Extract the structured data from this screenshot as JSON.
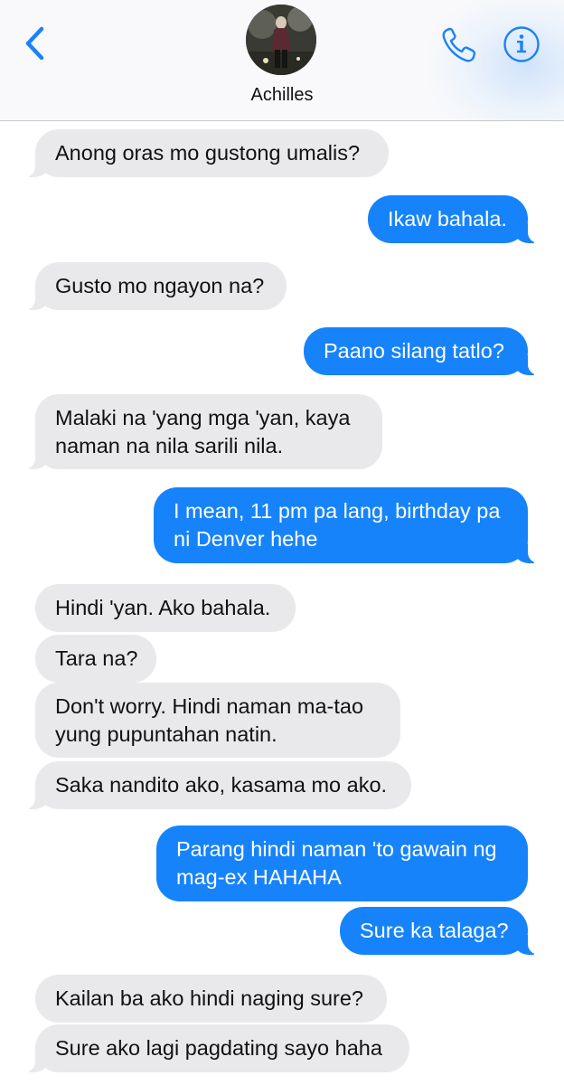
{
  "header": {
    "contact_name": "Achilles",
    "back_icon": "chevron-left-icon",
    "call_icon": "phone-icon",
    "info_icon": "info-icon",
    "accent_color": "#1a82fb"
  },
  "messages": [
    {
      "from": "them",
      "lines": [
        "Anong oras mo gustong umalis?"
      ]
    },
    {
      "from": "me",
      "lines": [
        "Ikaw bahala."
      ]
    },
    {
      "from": "them",
      "lines": [
        "Gusto mo ngayon na?"
      ]
    },
    {
      "from": "me",
      "lines": [
        "Paano silang tatlo?"
      ]
    },
    {
      "from": "them",
      "lines": [
        "Malaki na 'yang mga 'yan, kaya",
        "naman na nila sarili nila."
      ]
    },
    {
      "from": "me",
      "lines": [
        "I mean, 11 pm pa lang, birthday pa",
        "ni Denver hehe"
      ]
    },
    {
      "from": "them",
      "lines": [
        "Hindi 'yan. Ako bahala."
      ]
    },
    {
      "from": "them",
      "lines": [
        "Tara na?"
      ]
    },
    {
      "from": "them",
      "lines": [
        "Don't worry. Hindi naman ma-tao",
        "yung pupuntahan natin."
      ]
    },
    {
      "from": "them",
      "lines": [
        "Saka nandito ako, kasama mo ako."
      ]
    },
    {
      "from": "me",
      "lines": [
        "Parang hindi naman 'to gawain ng",
        "mag-ex HAHAHA"
      ]
    },
    {
      "from": "me",
      "lines": [
        "Sure ka talaga?"
      ]
    },
    {
      "from": "them",
      "lines": [
        "Kailan ba ako hindi naging sure?"
      ]
    },
    {
      "from": "them",
      "lines": [
        "Sure ako lagi pagdating sayo haha"
      ]
    }
  ]
}
